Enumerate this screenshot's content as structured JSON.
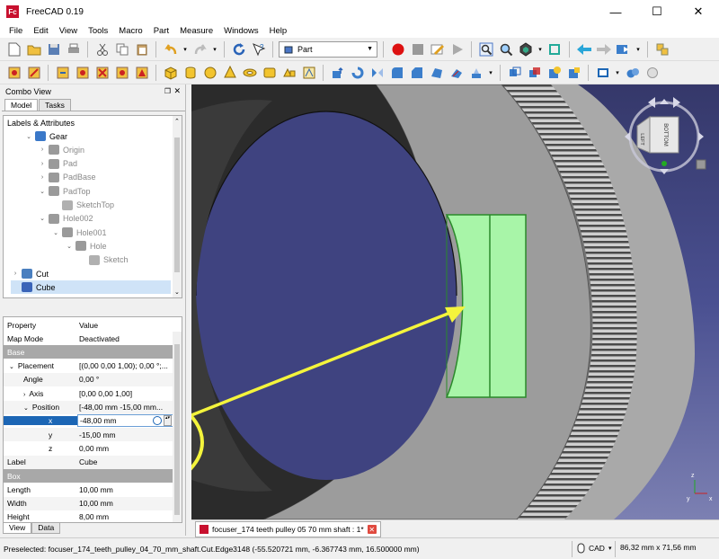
{
  "window": {
    "title": "FreeCAD 0.19",
    "app_badge": "Fc",
    "minimize": "—",
    "maximize": "☐",
    "close": "✕"
  },
  "menu": [
    "File",
    "Edit",
    "View",
    "Tools",
    "Macro",
    "Part",
    "Measure",
    "Windows",
    "Help"
  ],
  "workbench": {
    "selected": "Part"
  },
  "combo_view": {
    "title": "Combo View",
    "tabs": [
      "Model",
      "Tasks"
    ],
    "tree_header": "Labels & Attributes",
    "tree": [
      {
        "label": "Gear",
        "indent": 1,
        "expander": "⌄",
        "icon": "body-icon",
        "color": "#3a78c8",
        "muted": false
      },
      {
        "label": "Origin",
        "indent": 2,
        "expander": "›",
        "icon": "origin-icon",
        "color": "#9a9a9a",
        "muted": true
      },
      {
        "label": "Pad",
        "indent": 2,
        "expander": "›",
        "icon": "pad-icon",
        "color": "#9a9a9a",
        "muted": true
      },
      {
        "label": "PadBase",
        "indent": 2,
        "expander": "›",
        "icon": "pad-icon",
        "color": "#9a9a9a",
        "muted": true
      },
      {
        "label": "PadTop",
        "indent": 2,
        "expander": "⌄",
        "icon": "pad-icon",
        "color": "#9a9a9a",
        "muted": true
      },
      {
        "label": "SketchTop",
        "indent": 3,
        "expander": "",
        "icon": "sketch-icon",
        "color": "#b0b0b0",
        "muted": true
      },
      {
        "label": "Hole002",
        "indent": 2,
        "expander": "⌄",
        "icon": "hole-icon",
        "color": "#9a9a9a",
        "muted": true
      },
      {
        "label": "Hole001",
        "indent": 3,
        "expander": "⌄",
        "icon": "hole-icon",
        "color": "#9a9a9a",
        "muted": true
      },
      {
        "label": "Hole",
        "indent": 4,
        "expander": "⌄",
        "icon": "hole-icon",
        "color": "#9a9a9a",
        "muted": true
      },
      {
        "label": "Sketch",
        "indent": 5,
        "expander": "",
        "icon": "sketch-icon",
        "color": "#b0b0b0",
        "muted": true
      },
      {
        "label": "Cut",
        "indent": 0,
        "expander": "›",
        "icon": "cut-icon",
        "color": "#4a7fbf",
        "muted": false
      },
      {
        "label": "Cube",
        "indent": 0,
        "expander": "",
        "icon": "cube-icon",
        "color": "#3a64b8",
        "muted": false
      }
    ],
    "properties": {
      "col_property": "Property",
      "col_value": "Value",
      "rows": [
        {
          "name": "Map Mode",
          "value": "Deactivated",
          "kind": "normal"
        },
        {
          "name": "Base",
          "value": "",
          "kind": "group"
        },
        {
          "name": "Placement",
          "value": "[(0,00 0,00 1,00); 0,00 °;...",
          "kind": "normal",
          "expander": "⌄"
        },
        {
          "name": "Angle",
          "value": "0,00 °",
          "kind": "alt"
        },
        {
          "name": "Axis",
          "value": "[0,00 0,00 1,00]",
          "kind": "normal",
          "expander": "›"
        },
        {
          "name": "Position",
          "value": "[-48,00 mm  -15,00 mm...",
          "kind": "alt",
          "expander": "⌄"
        },
        {
          "name": "x",
          "value": "-48,00 mm",
          "kind": "edit"
        },
        {
          "name": "y",
          "value": "-15,00 mm",
          "kind": "alt"
        },
        {
          "name": "z",
          "value": "0,00 mm",
          "kind": "normal"
        },
        {
          "name": "Label",
          "value": "Cube",
          "kind": "alt"
        },
        {
          "name": "Box",
          "value": "",
          "kind": "group"
        },
        {
          "name": "Length",
          "value": "10,00 mm",
          "kind": "normal"
        },
        {
          "name": "Width",
          "value": "10,00 mm",
          "kind": "alt"
        },
        {
          "name": "Height",
          "value": "8,00 mm",
          "kind": "normal"
        }
      ]
    },
    "bottom_tabs": [
      "View",
      "Data"
    ]
  },
  "navcube": {
    "face_front": "BOTTOM",
    "face_side": "LEFT"
  },
  "axis_labels": {
    "z": "z",
    "y": "y",
    "x": "x"
  },
  "document_tab": {
    "label": "focuser_174 teeth pulley 05 70 mm shaft : 1*"
  },
  "status": {
    "message": "Preselected: focuser_174_teeth_pulley_04_70_mm_shaft.Cut.Edge3148 (-55.520721 mm, -6.367743 mm, 16.500000 mm)",
    "nav_style": "CAD",
    "dimensions": "86,32 mm x 71,56 mm"
  },
  "colors": {
    "accent_yellow": "#f4f43c",
    "cube_green": "#a8f5a8",
    "selection_blue": "#1c66b5"
  }
}
